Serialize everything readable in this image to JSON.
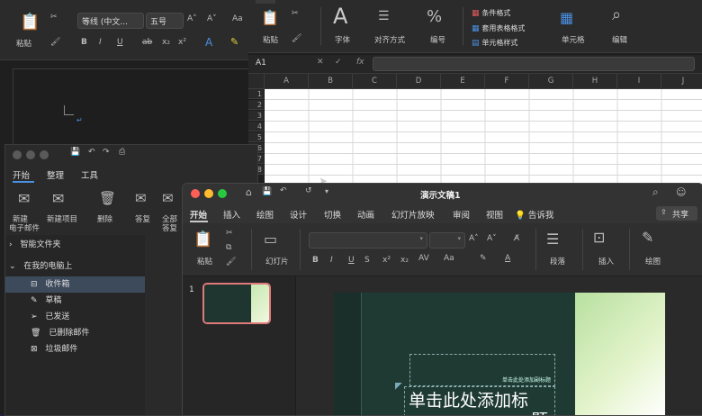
{
  "word": {
    "font_name": "等线 (中文...",
    "font_size": "五号",
    "paste_label": "粘贴"
  },
  "excel": {
    "groups": [
      "字体",
      "对齐方式",
      "编号",
      "单元格",
      "编辑"
    ],
    "paste_label": "粘贴",
    "styles": [
      "条件格式",
      "套用表格格式",
      "单元格样式"
    ],
    "name_box": "A1",
    "fx": "fx",
    "columns": [
      "A",
      "B",
      "C",
      "D",
      "E",
      "F",
      "G",
      "H",
      "I",
      "J"
    ],
    "rows": [
      "1",
      "2",
      "3",
      "4",
      "5",
      "6",
      "7",
      "8"
    ]
  },
  "outlook": {
    "tabs": [
      "开始",
      "整理",
      "工具"
    ],
    "buttons": [
      "新建\n电子邮件",
      "新建项目",
      "删除",
      "答复",
      "全部\n答复"
    ],
    "new_email_l1": "新建",
    "new_email_l2": "电子邮件",
    "reply_all_l1": "全部",
    "reply_all_l2": "答复",
    "smart_folders": "智能文件夹",
    "on_my_computer": "在我的电脑上",
    "folders": [
      "收件箱",
      "草稿",
      "已发送",
      "已删除邮件",
      "垃圾邮件"
    ]
  },
  "ppt": {
    "title": "演示文稿1",
    "tabs": [
      "开始",
      "插入",
      "绘图",
      "设计",
      "切换",
      "动画",
      "幻灯片放映",
      "审阅",
      "视图"
    ],
    "tell_me": "告诉我",
    "share": "共享",
    "paste": "粘贴",
    "slide_btn": "幻灯片",
    "paragraph": "段落",
    "insert": "插入",
    "draw": "绘图",
    "slide_number": "1",
    "subtitle_placeholder": "单击此处添加副标题",
    "title_placeholder_l1": "单击此处添加标",
    "title_placeholder_l2": "题"
  }
}
